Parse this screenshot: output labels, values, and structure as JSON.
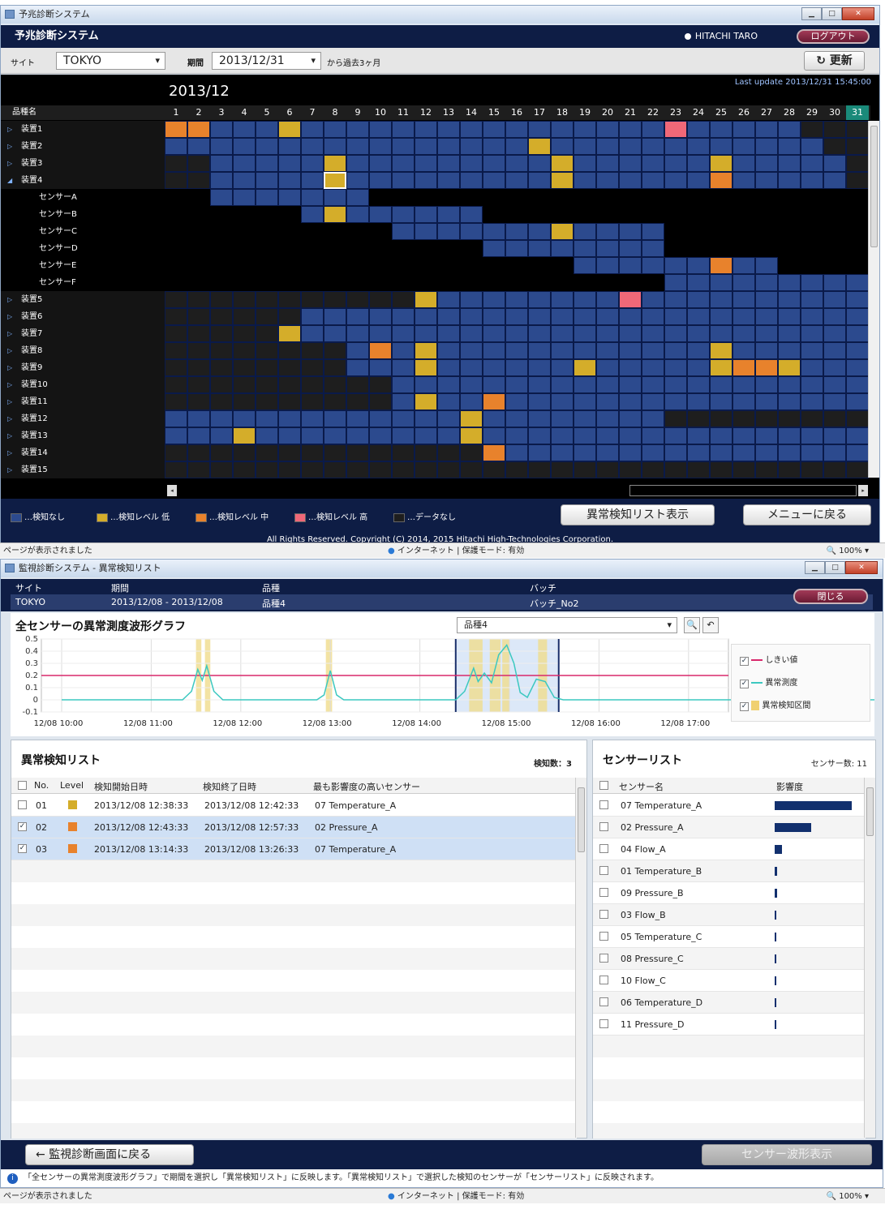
{
  "win1": {
    "title": "予兆診断システム",
    "app_title": "予兆診断システム",
    "user": "HITACHI TARO",
    "logout": "ログアウト",
    "site_label": "サイト",
    "site_value": "TOKYO",
    "period_label": "期間",
    "period_value": "2013/12/31",
    "period_suffix": "から過去3ヶ月",
    "refresh": "更新",
    "month": "2013/12",
    "last_update": "Last update 2013/12/31 15:45:00",
    "col_header": "品種名",
    "days": [
      "1",
      "2",
      "3",
      "4",
      "5",
      "6",
      "7",
      "8",
      "9",
      "10",
      "11",
      "12",
      "13",
      "14",
      "15",
      "16",
      "17",
      "18",
      "19",
      "20",
      "21",
      "22",
      "23",
      "24",
      "25",
      "26",
      "27",
      "28",
      "29",
      "30",
      "31"
    ],
    "rows": [
      {
        "name": "装置1",
        "expanded": false,
        "sub": false
      },
      {
        "name": "装置2",
        "expanded": false,
        "sub": false
      },
      {
        "name": "装置3",
        "expanded": false,
        "sub": false
      },
      {
        "name": "装置4",
        "expanded": true,
        "sub": false
      },
      {
        "name": "センサーA",
        "sub": true
      },
      {
        "name": "センサーB",
        "sub": true
      },
      {
        "name": "センサーC",
        "sub": true
      },
      {
        "name": "センサーD",
        "sub": true
      },
      {
        "name": "センサーE",
        "sub": true
      },
      {
        "name": "センサーF",
        "sub": true
      },
      {
        "name": "装置5",
        "sub": false
      },
      {
        "name": "装置6",
        "sub": false
      },
      {
        "name": "装置7",
        "sub": false
      },
      {
        "name": "装置8",
        "sub": false
      },
      {
        "name": "装置9",
        "sub": false
      },
      {
        "name": "装置10",
        "sub": false
      },
      {
        "name": "装置11",
        "sub": false
      },
      {
        "name": "装置12",
        "sub": false
      },
      {
        "name": "装置13",
        "sub": false
      },
      {
        "name": "装置14",
        "sub": false
      },
      {
        "name": "装置15",
        "sub": false
      }
    ],
    "grid": [
      "MMnnnLnnnnnnnnnnnnnnnnHnnnnnkkk",
      "nnnnnnnnnnnnnnnnLnnnnnnnnnnnnkk",
      "kknnnnnLnnnnnnnnnLnnnnnnLnnnnnk",
      "kknnnnnSnnnnnnnnnLnnnnnnMnnnnnk",
      "xxnnnnnnnxxxxxxxxxxxxxxxxxxxxxx",
      "xxxxxxnLnnnnnnxxxxxxxxxxxxxxxxx",
      "xxxxxxxxxxnnnnnnnLnnnnxxxxxxxxx",
      "xxxxxxxxxxxxxxnnnnnnnnxxxxxxxxx",
      "xxxxxxxxxxxxxxxxxxnnnnnnMnnxxxx",
      "xxxxxxxxxxxxxxxxxxxxxxnnnnnnnnn",
      "kkkkkkkkkkkLnnnnnnnnHnnnnnnnnnn",
      "kkkkkknnnnnnnnnnnnnnnnnnnnnnnnn",
      "kkkkkLnnnnnnnnnnnnnnnnnnnnnnnnn",
      "kkkkkkkknMnLnnnnnnnnnnnnLnnnnnn",
      "kkkkkkkknnnLnnnnnnLnnnnnLMMLnnn",
      "kkkkkkkkkknnnnnnnnnnnnnnnnnnnnn",
      "kkkkkkkkkknLnnMnnnnnnnnnnnnnnnn",
      "nnnnnnnnnnnnnLnnnnnnnnkkkkkkkkk",
      "nnnLnnnnnnnnnLnnnnnnnnnnnnnnnnn",
      "kkkkkkkkkkkkkkMnnnnnnnnnnnnnnnn",
      "kkkkkkkkkkkkkkkkkkkkkkkkkkkkkkk"
    ],
    "legend": [
      "…検知なし",
      "…検知レベル 低",
      "…検知レベル 中",
      "…検知レベル 高",
      "…データなし"
    ],
    "btn_list": "異常検知リスト表示",
    "btn_menu": "メニューに戻る",
    "copyright": "All Rights Reserved. Copyright (C) 2014, 2015 Hitachi High-Technologies Corporation.",
    "status": "ページが表示されました",
    "zone": "インターネット | 保護モード: 有効",
    "zoom": "100%"
  },
  "colors": {
    "none": "#2c4a8e",
    "low": "#d4ad2a",
    "mid": "#e8822c",
    "high": "#f06878",
    "nodata": "#1e1e1e",
    "navy": "#0e1d45"
  },
  "win2": {
    "title": "監視診断システム - 異常検知リスト",
    "hdr_site_label": "サイト",
    "hdr_period_label": "期間",
    "hdr_type_label": "品種",
    "hdr_batch_label": "バッチ",
    "hdr_site": "TOKYO",
    "hdr_period": "2013/12/08 - 2013/12/08",
    "hdr_type": "品種4",
    "hdr_batch": "バッチ_No2",
    "close": "閉じる",
    "graph_title": "全センサーの異常測度波形グラフ",
    "graph_select": "品種4",
    "legend": [
      "しきい値",
      "異常測度",
      "異常検知区間"
    ],
    "list_title": "異常検知リスト",
    "list_count": "検知数：3",
    "list_cols": [
      "No.",
      "Level",
      "検知開始日時",
      "検知終了日時",
      "最も影響度の高いセンサー"
    ],
    "list_rows": [
      {
        "no": "01",
        "level": "low",
        "start": "2013/12/08 12:38:33",
        "end": "2013/12/08 12:42:33",
        "sensor": "07 Temperature_A",
        "checked": false
      },
      {
        "no": "02",
        "level": "mid",
        "start": "2013/12/08 12:43:33",
        "end": "2013/12/08 12:57:33",
        "sensor": "02 Pressure_A",
        "checked": true
      },
      {
        "no": "03",
        "level": "mid",
        "start": "2013/12/08 13:14:33",
        "end": "2013/12/08 13:26:33",
        "sensor": "07 Temperature_A",
        "checked": true
      }
    ],
    "sensor_title": "センサーリスト",
    "sensor_count": "センサー数: 11",
    "sensor_cols": [
      "センサー名",
      "影響度"
    ],
    "sensors": [
      {
        "name": "07 Temperature_A",
        "impact": 0.95
      },
      {
        "name": "02 Pressure_A",
        "impact": 0.45
      },
      {
        "name": "04 Flow_A",
        "impact": 0.09
      },
      {
        "name": "01 Temperature_B",
        "impact": 0.03
      },
      {
        "name": "09  Pressure_B",
        "impact": 0.025
      },
      {
        "name": "03 Flow_B",
        "impact": 0.022
      },
      {
        "name": "05 Temperature_C",
        "impact": 0.02
      },
      {
        "name": "08 Pressure_C",
        "impact": 0.015
      },
      {
        "name": "10 Flow_C",
        "impact": 0.012
      },
      {
        "name": "06 Temperature_D",
        "impact": 0.01
      },
      {
        "name": "11 Pressure_D",
        "impact": 0.008
      }
    ],
    "back": "監視診断画面に戻る",
    "waveform": "センサー波形表示",
    "info": "「全センサーの異常測度波形グラフ」で期間を選択し「異常検知リスト」に反映します。「異常検知リスト」で選択した検知のセンサーが「センサーリスト」に反映されます。",
    "status": "ページが表示されました",
    "zone": "インターネット | 保護モード: 有効",
    "zoom": "100%"
  },
  "chart_data": {
    "type": "line",
    "x_ticks": [
      "12/08 10:00",
      "12/08 11:00",
      "12/08 12:00",
      "12/08 13:00",
      "12/08 14:00",
      "12/08 15:00",
      "12/08 16:00",
      "12/08 17:00"
    ],
    "y_ticks": [
      "0.5",
      "0.4",
      "0.3",
      "0.2",
      "0.1",
      "0",
      "-0.1"
    ],
    "ylim": [
      -0.1,
      0.5
    ],
    "threshold": 0.2,
    "series": [
      {
        "name": "異常測度",
        "points": [
          [
            0,
            0
          ],
          [
            1.35,
            0
          ],
          [
            1.45,
            0.07
          ],
          [
            1.52,
            0.25
          ],
          [
            1.57,
            0.16
          ],
          [
            1.62,
            0.28
          ],
          [
            1.7,
            0.07
          ],
          [
            1.8,
            0
          ],
          [
            2.85,
            0
          ],
          [
            2.93,
            0.04
          ],
          [
            3.0,
            0.24
          ],
          [
            3.07,
            0.04
          ],
          [
            3.15,
            0
          ],
          [
            4.4,
            0
          ],
          [
            4.5,
            0.07
          ],
          [
            4.6,
            0.26
          ],
          [
            4.65,
            0.15
          ],
          [
            4.72,
            0.22
          ],
          [
            4.8,
            0.14
          ],
          [
            4.88,
            0.37
          ],
          [
            4.97,
            0.45
          ],
          [
            5.05,
            0.3
          ],
          [
            5.12,
            0.06
          ],
          [
            5.2,
            0.02
          ],
          [
            5.3,
            0.17
          ],
          [
            5.4,
            0.15
          ],
          [
            5.5,
            0.02
          ],
          [
            5.6,
            0
          ],
          [
            10,
            0
          ]
        ]
      }
    ],
    "spans": [
      [
        1.5,
        1.56
      ],
      [
        1.6,
        1.66
      ],
      [
        2.95,
        3.02
      ],
      [
        4.55,
        4.7
      ],
      [
        4.78,
        4.9
      ],
      [
        4.92,
        5.0
      ],
      [
        5.32,
        5.42
      ]
    ]
  }
}
